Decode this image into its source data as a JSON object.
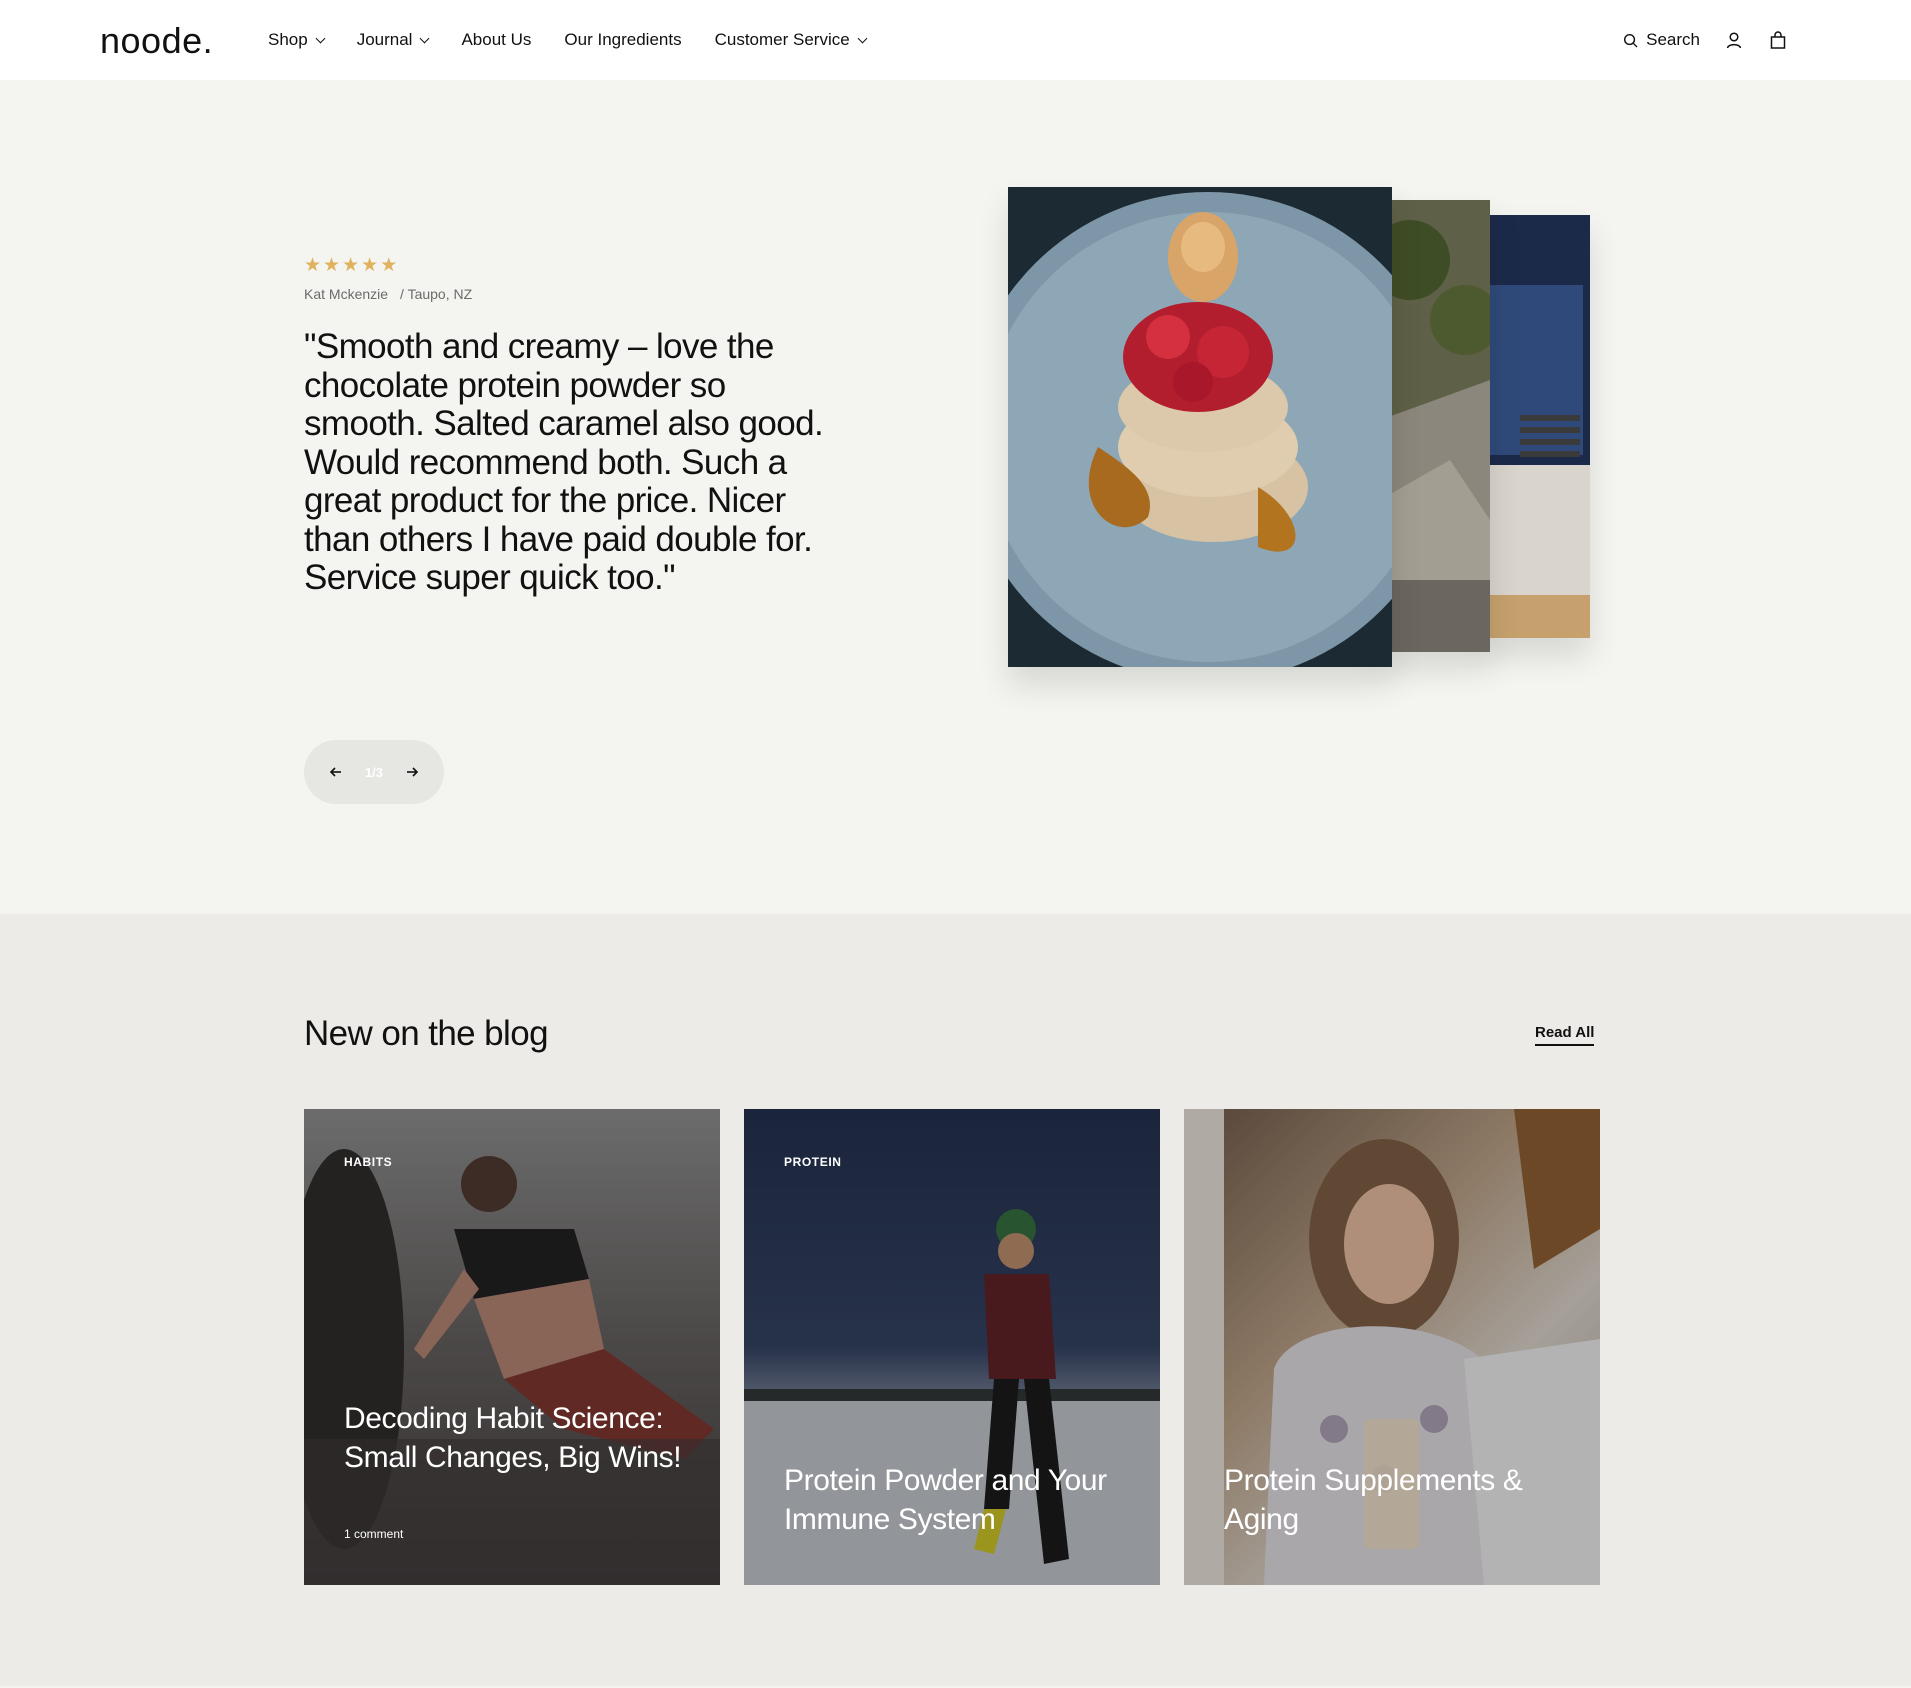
{
  "header": {
    "logo": "noode.",
    "nav": [
      {
        "label": "Shop",
        "dropdown": true
      },
      {
        "label": "Journal",
        "dropdown": true
      },
      {
        "label": "About Us",
        "dropdown": false
      },
      {
        "label": "Our Ingredients",
        "dropdown": false
      },
      {
        "label": "Customer Service",
        "dropdown": true
      }
    ],
    "search_label": "Search"
  },
  "testimonial": {
    "rating": 5,
    "author": "Kat Mckenzie",
    "location": "/ Taupo, NZ",
    "quote": "\"Smooth and creamy – love the chocolate protein powder so smooth. Salted caramel also good. Would recommend both. Such a great product for the price. Nicer than others I have paid double for. Service super quick too.\"",
    "pager": "1/3",
    "star_color": "#e0b25d"
  },
  "blog": {
    "title": "New on the blog",
    "read_all": "Read All",
    "posts": [
      {
        "tag": "HABITS",
        "title": "Decoding Habit Science: Small Changes, Big Wins!",
        "comments": "1 comment"
      },
      {
        "tag": "PROTEIN",
        "title": "Protein Powder and Your Immune System",
        "comments": ""
      },
      {
        "tag": "",
        "title": "Protein Supplements & Aging",
        "comments": ""
      }
    ]
  }
}
